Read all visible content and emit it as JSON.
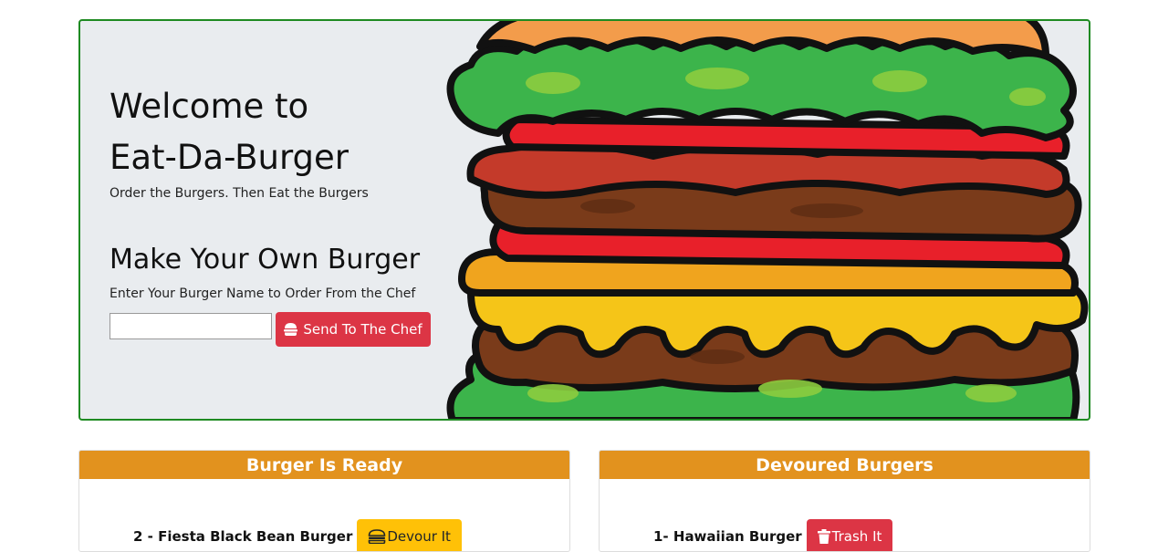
{
  "hero": {
    "title_line1": "Welcome to",
    "title_line2": "Eat-Da-Burger",
    "tagline": "Order the Burgers. Then Eat the Burgers",
    "make_title": "Make Your Own Burger",
    "make_subtitle": "Enter Your Burger Name to Order From the Chef",
    "input_value": "",
    "send_button_label": "Send To The Chef",
    "send_icon": "hamburger-icon",
    "burger_image": "burger-illustration"
  },
  "ready": {
    "header": "Burger Is Ready",
    "items": [
      {
        "name": "2 - Fiesta Black Bean Burger",
        "button_label": "Devour It",
        "button_icon": "hamburger-icon"
      }
    ]
  },
  "devoured": {
    "header": "Devoured Burgers",
    "items": [
      {
        "name": "1- Hawaiian Burger",
        "button_label": "Trash It",
        "button_icon": "trash-icon"
      }
    ]
  },
  "colors": {
    "jumbotron_border": "#1e8a22",
    "jumbotron_bg": "#e9ecef",
    "panel_header": "#e2921e",
    "danger": "#dc3545",
    "warning": "#ffc107"
  }
}
